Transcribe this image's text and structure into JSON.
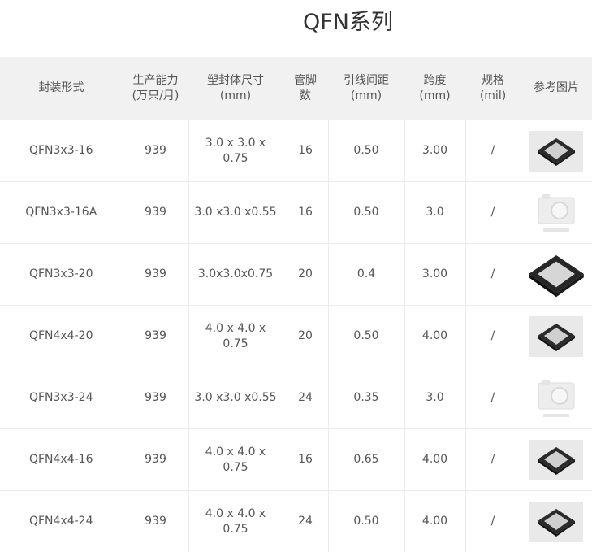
{
  "title": "QFN系列",
  "headers": [
    {
      "line1": "封装形式",
      "line2": ""
    },
    {
      "line1": "生产能力",
      "line2": "(万只/月)"
    },
    {
      "line1": "塑封体尺寸",
      "line2": "(mm)"
    },
    {
      "line1": "管脚",
      "line2": "数"
    },
    {
      "line1": "引线间距",
      "line2": "(mm)"
    },
    {
      "line1": "跨度",
      "line2": "(mm)"
    },
    {
      "line1": "规格",
      "line2": "(mil)"
    },
    {
      "line1": "参考图片",
      "line2": ""
    }
  ],
  "rows": [
    {
      "package": "QFN3x3-16",
      "capacity": "939",
      "size": "3.0 x 3.0 x 0.75",
      "pins": "16",
      "pitch": "0.50",
      "span": "3.00",
      "spec": "/",
      "image": "qfn-chip-photo"
    },
    {
      "package": "QFN3x3-16A",
      "capacity": "939",
      "size": "3.0 x3.0 x0.55",
      "pins": "16",
      "pitch": "0.50",
      "span": "3.0",
      "spec": "/",
      "image": "camera-placeholder-icon"
    },
    {
      "package": "QFN3x3-20",
      "capacity": "939",
      "size": "3.0x3.0x0.75",
      "pins": "20",
      "pitch": "0.4",
      "span": "3.00",
      "spec": "/",
      "image": "qfn-chip-large-photo"
    },
    {
      "package": "QFN4x4-20",
      "capacity": "939",
      "size": "4.0 x 4.0 x 0.75",
      "pins": "20",
      "pitch": "0.50",
      "span": "4.00",
      "spec": "/",
      "image": "qfn-chip-photo"
    },
    {
      "package": "QFN3x3-24",
      "capacity": "939",
      "size": "3.0 x3.0 x0.55",
      "pins": "24",
      "pitch": "0.35",
      "span": "3.0",
      "spec": "/",
      "image": "camera-placeholder-icon"
    },
    {
      "package": "QFN4x4-16",
      "capacity": "939",
      "size": "4.0 x 4.0 x 0.75",
      "pins": "16",
      "pitch": "0.65",
      "span": "4.00",
      "spec": "/",
      "image": "qfn-chip-photo"
    },
    {
      "package": "QFN4x4-24",
      "capacity": "939",
      "size": "4.0 x 4.0 x 0.75",
      "pins": "24",
      "pitch": "0.50",
      "span": "4.00",
      "spec": "/",
      "image": "qfn-chip-photo"
    }
  ]
}
